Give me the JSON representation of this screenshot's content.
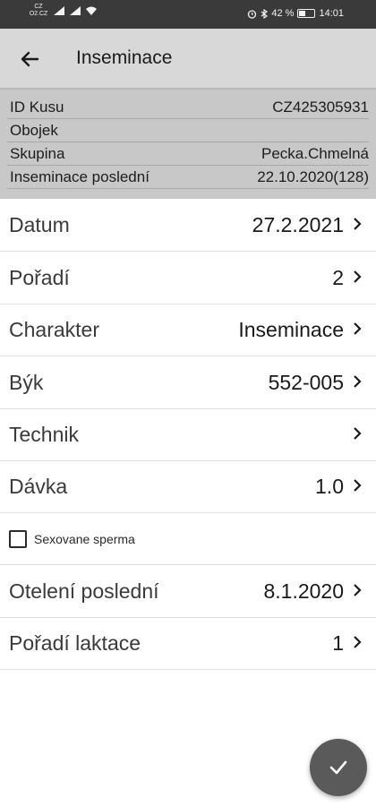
{
  "status_bar": {
    "carrier_top": "CZ",
    "carrier_bottom": "O2.CZ",
    "battery_text": "42 %",
    "time": "14:01"
  },
  "app_bar": {
    "title": "Inseminace"
  },
  "info": [
    {
      "key": "ID Kusu",
      "value": "CZ425305931"
    },
    {
      "key": "Obojek",
      "value": ""
    },
    {
      "key": "Skupina",
      "value": "Pecka.Chmelná"
    },
    {
      "key": "Inseminace poslední",
      "value": "22.10.2020(128)"
    }
  ],
  "form": {
    "datum": {
      "label": "Datum",
      "value": "27.2.2021"
    },
    "poradi": {
      "label": "Pořadí",
      "value": "2"
    },
    "charakter": {
      "label": "Charakter",
      "value": "Inseminace"
    },
    "byk": {
      "label": "Býk",
      "value": "552-005"
    },
    "technik": {
      "label": "Technik",
      "value": ""
    },
    "davka": {
      "label": "Dávka",
      "value": "1.0"
    },
    "sexovane": {
      "label": "Sexovane sperma"
    },
    "oteleni": {
      "label": "Otelení poslední",
      "value": "8.1.2020"
    },
    "laktace": {
      "label": "Pořadí laktace",
      "value": "1"
    }
  },
  "icons": {
    "back": "arrow-left-icon",
    "chevron": "chevron-right-icon",
    "fab": "check-icon"
  },
  "colors": {
    "status_bar": "#3a3a3a",
    "app_bar": "#d8d8d8",
    "info_bg": "#c8c8c8",
    "fab": "#5a5a5a"
  }
}
